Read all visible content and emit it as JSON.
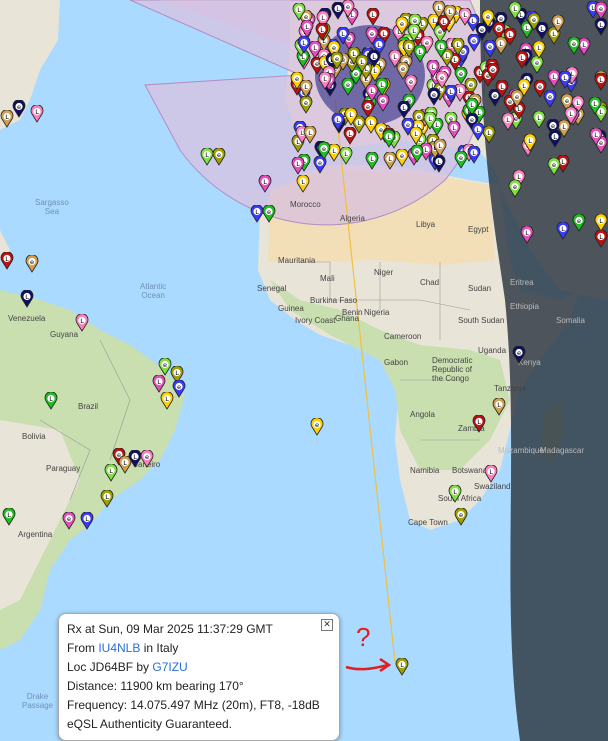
{
  "map": {
    "labels": {
      "sargasso_sea": "Sargasso\nSea",
      "atlantic_ocean": "Atlantic\nOcean",
      "venezuela": "Venezuela",
      "guyana": "Guyana",
      "brazil": "Brazil",
      "bolivia": "Bolivia",
      "paraguay": "Paraguay",
      "argentina": "Argentina",
      "rio": "Janeiro",
      "morocco": "Morocco",
      "algeria": "Algeria",
      "libya": "Libya",
      "egypt": "Egypt",
      "mauritania": "Mauritania",
      "mali": "Mali",
      "niger": "Niger",
      "chad": "Chad",
      "sudan": "Sudan",
      "senegal": "Senegal",
      "burkina_faso": "Burkina Faso",
      "guinea": "Guinea",
      "ivory_coast": "Ivory Coast",
      "ghana": "Ghana",
      "benin": "Benin",
      "nigeria": "Nigeria",
      "cameroon": "Cameroon",
      "gabon": "Gabon",
      "drc": "Democratic\nRepublic of\nthe Congo",
      "uganda": "Uganda",
      "kenya": "Kenya",
      "south_sudan": "South Sudan",
      "ethiopia": "Ethiopia",
      "eritrea": "Eritrea",
      "somalia": "Somalia",
      "tanzania": "Tanzania",
      "angola": "Angola",
      "zambia": "Zambia",
      "mozambique": "Mozambique",
      "madagascar": "Madagascar",
      "namibia": "Namibia",
      "botswana": "Botswana",
      "south_africa": "South Africa",
      "swaziland": "Swaziland",
      "cape_town": "Cape Town",
      "drake_passage": "Drake\nPassage"
    },
    "colors": {
      "ocean": "#aadaff",
      "land": "#e8e4d8",
      "green_land": "#c9dfb0",
      "desert": "#f2dfb8",
      "night": "#2b3440",
      "beam": "#d8c0e0",
      "path": "#f0c040"
    }
  },
  "popup": {
    "line1": "Rx at Sun, 09 Mar 2025 11:37:29 GMT",
    "from_prefix": "From ",
    "from_call": "IU4NLB",
    "from_suffix": " in Italy",
    "loc_prefix": "Loc JD64BF by ",
    "loc_call": "G7IZU",
    "distance": "Distance: 11900 km bearing 170°",
    "frequency": "Frequency: 14.075.497 MHz (20m), FT8, -18dB",
    "eqsl": "eQSL Authenticity Guaranteed.",
    "close_icon": "close-icon"
  },
  "annotation": {
    "question": "?",
    "color": "#e02020"
  },
  "pins": {
    "letters": {
      "L": "L",
      "e": "e"
    },
    "colors": [
      "#e84cc0",
      "#3a3aff",
      "#20c020",
      "#ffd000",
      "#c01010",
      "#d0a050",
      "#101060",
      "#ff80c0",
      "#80e040",
      "#a0a000"
    ]
  }
}
